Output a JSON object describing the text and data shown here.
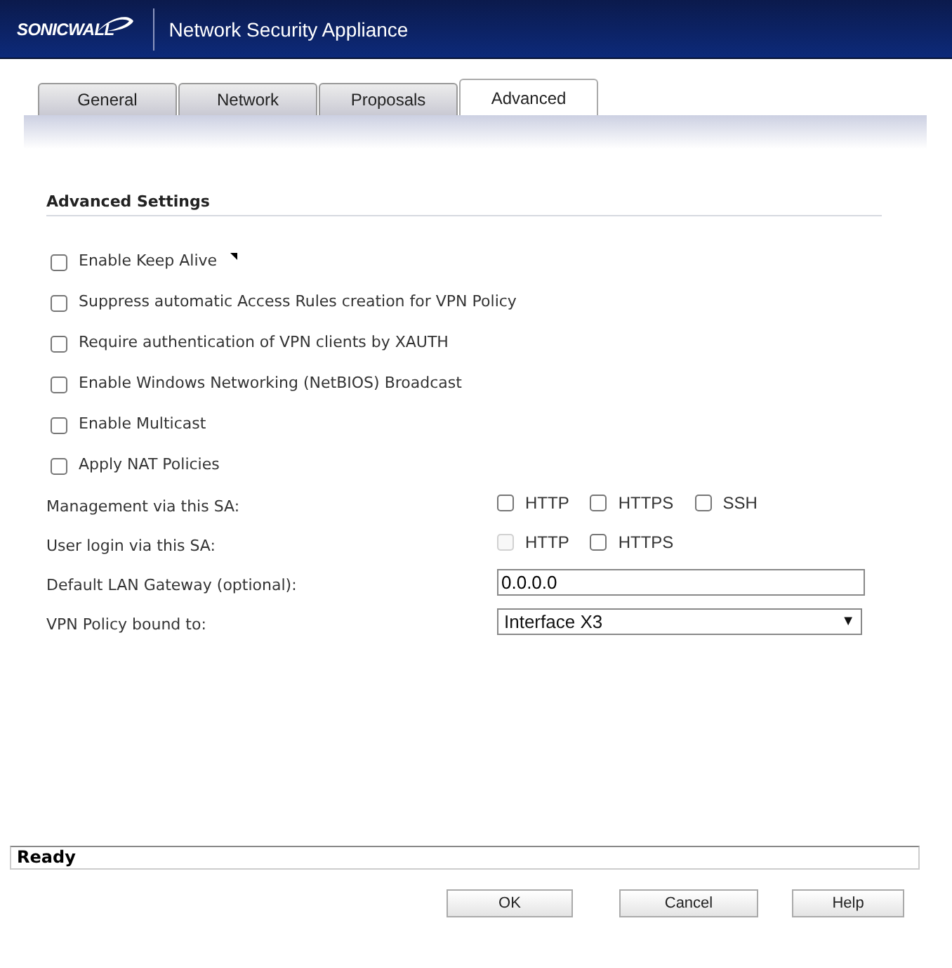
{
  "header": {
    "logo": "SONICWALL",
    "title": "Network Security Appliance"
  },
  "tabs": [
    {
      "label": "General",
      "selected": false
    },
    {
      "label": "Network",
      "selected": false
    },
    {
      "label": "Proposals",
      "selected": false
    },
    {
      "label": "Advanced",
      "selected": true
    }
  ],
  "section_title": "Advanced Settings",
  "options": [
    {
      "label": "Enable Keep Alive",
      "checked": false,
      "marker": true
    },
    {
      "label": "Suppress automatic Access Rules creation for VPN Policy",
      "checked": false
    },
    {
      "label": "Require authentication of VPN clients by XAUTH",
      "checked": false
    },
    {
      "label": "Enable Windows Networking (NetBIOS) Broadcast",
      "checked": false
    },
    {
      "label": "Enable Multicast",
      "checked": false
    },
    {
      "label": "Apply NAT Policies",
      "checked": false
    }
  ],
  "fields": [
    {
      "kind": "checks",
      "label": "Management via this SA:",
      "checks": [
        {
          "label": "HTTP",
          "checked": false,
          "disabled": false
        },
        {
          "label": "HTTPS",
          "checked": false,
          "disabled": false
        },
        {
          "label": "SSH",
          "checked": false,
          "disabled": false
        }
      ]
    },
    {
      "kind": "checks",
      "label": "User login via this SA:",
      "checks": [
        {
          "label": "HTTP",
          "checked": false,
          "disabled": true
        },
        {
          "label": "HTTPS",
          "checked": false,
          "disabled": false
        }
      ]
    },
    {
      "kind": "text",
      "label": "Default LAN Gateway (optional):",
      "value": "0.0.0.0"
    },
    {
      "kind": "select",
      "label": "VPN Policy bound to:",
      "value": "Interface X3",
      "arrow": "▼"
    }
  ],
  "status": "Ready",
  "buttons": [
    "OK",
    "Cancel",
    "Help"
  ]
}
